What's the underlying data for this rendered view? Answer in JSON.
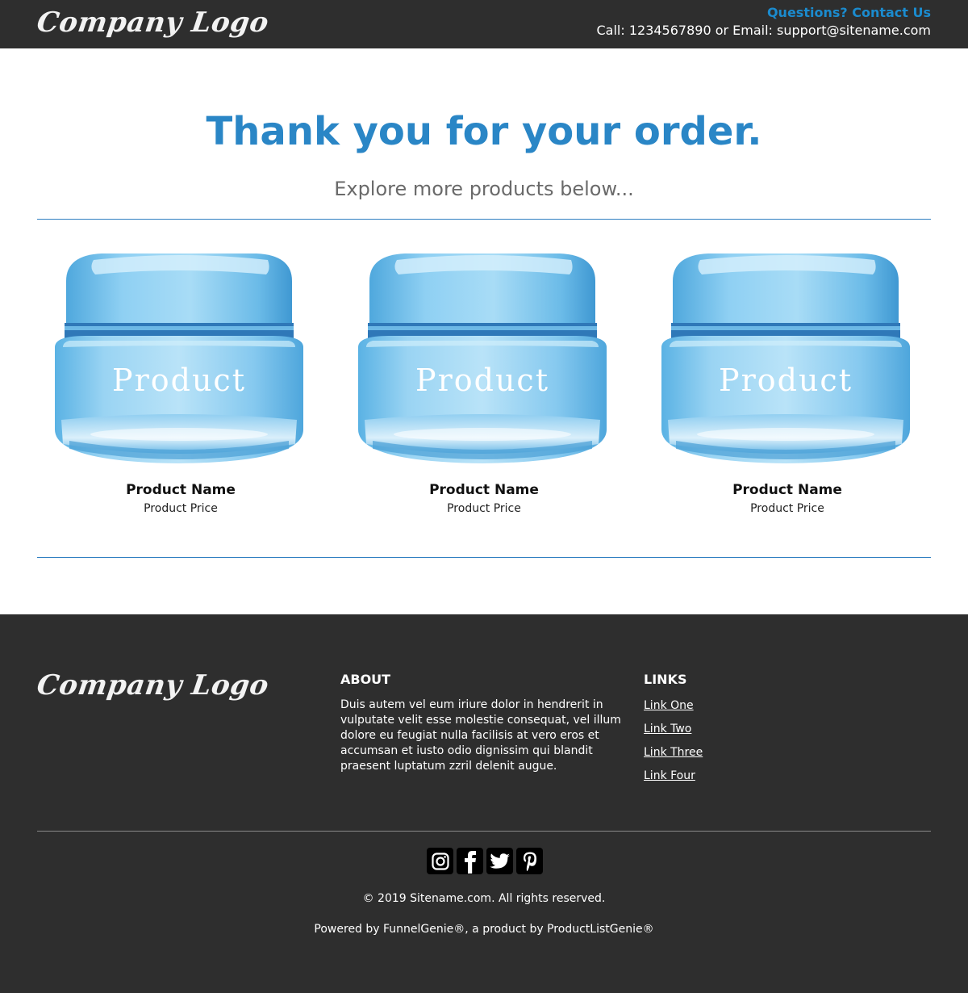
{
  "header": {
    "logo_text": "Company Logo",
    "contact_link": "Questions? Contact Us",
    "contact_info": "Call: 1234567890 or Email: support@sitename.com"
  },
  "hero": {
    "title": "Thank you for your order.",
    "subtitle": "Explore more products below..."
  },
  "products": [
    {
      "image_label": "Product",
      "name": "Product Name",
      "price": "Product Price"
    },
    {
      "image_label": "Product",
      "name": "Product Name",
      "price": "Product Price"
    },
    {
      "image_label": "Product",
      "name": "Product Name",
      "price": "Product Price"
    }
  ],
  "footer": {
    "logo_text": "Company Logo",
    "about_heading": "ABOUT",
    "about_text": "Duis autem vel eum iriure dolor in hendrerit in vulputate velit esse molestie consequat, vel illum dolore eu feugiat nulla facilisis at vero eros et accumsan et iusto odio dignissim qui blandit praesent luptatum zzril delenit augue.",
    "links_heading": "LINKS",
    "links": [
      "Link One",
      "Link Two",
      "Link Three",
      "Link Four"
    ],
    "socials": [
      "instagram-icon",
      "facebook-icon",
      "twitter-icon",
      "pinterest-icon"
    ],
    "copyright": "© 2019 Sitename.com. All rights reserved.",
    "powered": "Powered by FunnelGenie®, a product by ProductListGenie®"
  },
  "colors": {
    "accent": "#2a86c6",
    "link_blue": "#1b8bce",
    "dark_bg": "#2e2e2e"
  }
}
